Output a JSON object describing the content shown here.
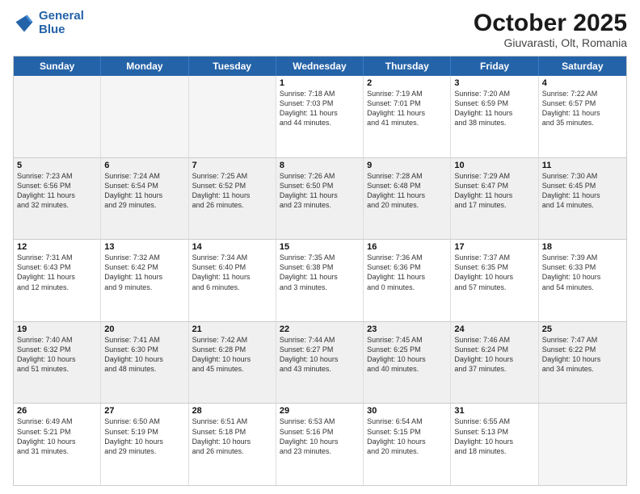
{
  "logo": {
    "line1": "General",
    "line2": "Blue"
  },
  "title": "October 2025",
  "subtitle": "Giuvarasti, Olt, Romania",
  "days": [
    "Sunday",
    "Monday",
    "Tuesday",
    "Wednesday",
    "Thursday",
    "Friday",
    "Saturday"
  ],
  "rows": [
    [
      {
        "day": "",
        "text": ""
      },
      {
        "day": "",
        "text": ""
      },
      {
        "day": "",
        "text": ""
      },
      {
        "day": "1",
        "text": "Sunrise: 7:18 AM\nSunset: 7:03 PM\nDaylight: 11 hours\nand 44 minutes."
      },
      {
        "day": "2",
        "text": "Sunrise: 7:19 AM\nSunset: 7:01 PM\nDaylight: 11 hours\nand 41 minutes."
      },
      {
        "day": "3",
        "text": "Sunrise: 7:20 AM\nSunset: 6:59 PM\nDaylight: 11 hours\nand 38 minutes."
      },
      {
        "day": "4",
        "text": "Sunrise: 7:22 AM\nSunset: 6:57 PM\nDaylight: 11 hours\nand 35 minutes."
      }
    ],
    [
      {
        "day": "5",
        "text": "Sunrise: 7:23 AM\nSunset: 6:56 PM\nDaylight: 11 hours\nand 32 minutes."
      },
      {
        "day": "6",
        "text": "Sunrise: 7:24 AM\nSunset: 6:54 PM\nDaylight: 11 hours\nand 29 minutes."
      },
      {
        "day": "7",
        "text": "Sunrise: 7:25 AM\nSunset: 6:52 PM\nDaylight: 11 hours\nand 26 minutes."
      },
      {
        "day": "8",
        "text": "Sunrise: 7:26 AM\nSunset: 6:50 PM\nDaylight: 11 hours\nand 23 minutes."
      },
      {
        "day": "9",
        "text": "Sunrise: 7:28 AM\nSunset: 6:48 PM\nDaylight: 11 hours\nand 20 minutes."
      },
      {
        "day": "10",
        "text": "Sunrise: 7:29 AM\nSunset: 6:47 PM\nDaylight: 11 hours\nand 17 minutes."
      },
      {
        "day": "11",
        "text": "Sunrise: 7:30 AM\nSunset: 6:45 PM\nDaylight: 11 hours\nand 14 minutes."
      }
    ],
    [
      {
        "day": "12",
        "text": "Sunrise: 7:31 AM\nSunset: 6:43 PM\nDaylight: 11 hours\nand 12 minutes."
      },
      {
        "day": "13",
        "text": "Sunrise: 7:32 AM\nSunset: 6:42 PM\nDaylight: 11 hours\nand 9 minutes."
      },
      {
        "day": "14",
        "text": "Sunrise: 7:34 AM\nSunset: 6:40 PM\nDaylight: 11 hours\nand 6 minutes."
      },
      {
        "day": "15",
        "text": "Sunrise: 7:35 AM\nSunset: 6:38 PM\nDaylight: 11 hours\nand 3 minutes."
      },
      {
        "day": "16",
        "text": "Sunrise: 7:36 AM\nSunset: 6:36 PM\nDaylight: 11 hours\nand 0 minutes."
      },
      {
        "day": "17",
        "text": "Sunrise: 7:37 AM\nSunset: 6:35 PM\nDaylight: 10 hours\nand 57 minutes."
      },
      {
        "day": "18",
        "text": "Sunrise: 7:39 AM\nSunset: 6:33 PM\nDaylight: 10 hours\nand 54 minutes."
      }
    ],
    [
      {
        "day": "19",
        "text": "Sunrise: 7:40 AM\nSunset: 6:32 PM\nDaylight: 10 hours\nand 51 minutes."
      },
      {
        "day": "20",
        "text": "Sunrise: 7:41 AM\nSunset: 6:30 PM\nDaylight: 10 hours\nand 48 minutes."
      },
      {
        "day": "21",
        "text": "Sunrise: 7:42 AM\nSunset: 6:28 PM\nDaylight: 10 hours\nand 45 minutes."
      },
      {
        "day": "22",
        "text": "Sunrise: 7:44 AM\nSunset: 6:27 PM\nDaylight: 10 hours\nand 43 minutes."
      },
      {
        "day": "23",
        "text": "Sunrise: 7:45 AM\nSunset: 6:25 PM\nDaylight: 10 hours\nand 40 minutes."
      },
      {
        "day": "24",
        "text": "Sunrise: 7:46 AM\nSunset: 6:24 PM\nDaylight: 10 hours\nand 37 minutes."
      },
      {
        "day": "25",
        "text": "Sunrise: 7:47 AM\nSunset: 6:22 PM\nDaylight: 10 hours\nand 34 minutes."
      }
    ],
    [
      {
        "day": "26",
        "text": "Sunrise: 6:49 AM\nSunset: 5:21 PM\nDaylight: 10 hours\nand 31 minutes."
      },
      {
        "day": "27",
        "text": "Sunrise: 6:50 AM\nSunset: 5:19 PM\nDaylight: 10 hours\nand 29 minutes."
      },
      {
        "day": "28",
        "text": "Sunrise: 6:51 AM\nSunset: 5:18 PM\nDaylight: 10 hours\nand 26 minutes."
      },
      {
        "day": "29",
        "text": "Sunrise: 6:53 AM\nSunset: 5:16 PM\nDaylight: 10 hours\nand 23 minutes."
      },
      {
        "day": "30",
        "text": "Sunrise: 6:54 AM\nSunset: 5:15 PM\nDaylight: 10 hours\nand 20 minutes."
      },
      {
        "day": "31",
        "text": "Sunrise: 6:55 AM\nSunset: 5:13 PM\nDaylight: 10 hours\nand 18 minutes."
      },
      {
        "day": "",
        "text": ""
      }
    ]
  ]
}
